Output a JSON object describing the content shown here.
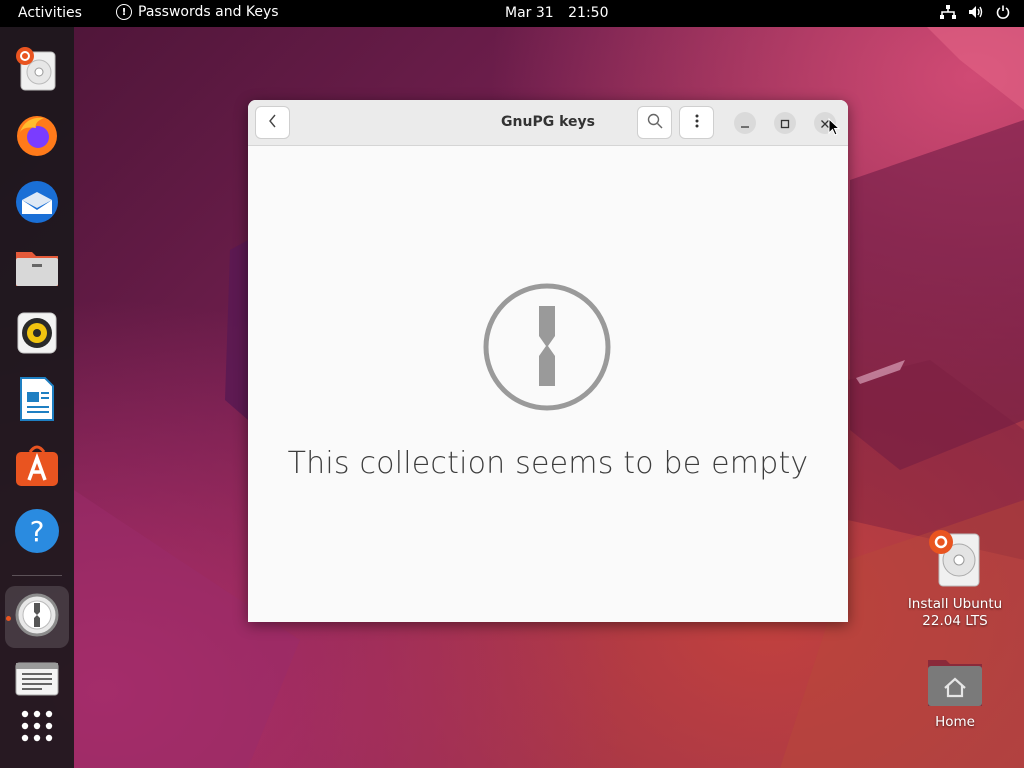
{
  "topbar": {
    "activities": "Activities",
    "app_name": "Passwords and Keys",
    "date": "Mar 31",
    "time": "21:50"
  },
  "dock": {
    "items": [
      {
        "name": "install-ubuntu",
        "icon": "ubuntu-installer-icon"
      },
      {
        "name": "firefox",
        "icon": "firefox-icon"
      },
      {
        "name": "thunderbird",
        "icon": "thunderbird-icon"
      },
      {
        "name": "files",
        "icon": "files-icon"
      },
      {
        "name": "rhythmbox",
        "icon": "rhythmbox-icon"
      },
      {
        "name": "libreoffice-writer",
        "icon": "writer-icon"
      },
      {
        "name": "app-center",
        "icon": "app-center-icon"
      },
      {
        "name": "help",
        "icon": "help-icon"
      },
      {
        "name": "passwords-and-keys",
        "icon": "seahorse-icon",
        "active": true
      },
      {
        "name": "text-editor",
        "icon": "text-editor-icon"
      },
      {
        "name": "show-apps",
        "icon": "app-grid-icon"
      }
    ]
  },
  "desktop": {
    "install_label_line1": "Install Ubuntu",
    "install_label_line2": "22.04 LTS",
    "home_label": "Home"
  },
  "window": {
    "title": "GnuPG keys",
    "empty_message": "This collection seems to be empty"
  },
  "colors": {
    "accent": "#e95420",
    "window_bg": "#fafafa",
    "headerbar_bg": "#ebebeb"
  }
}
